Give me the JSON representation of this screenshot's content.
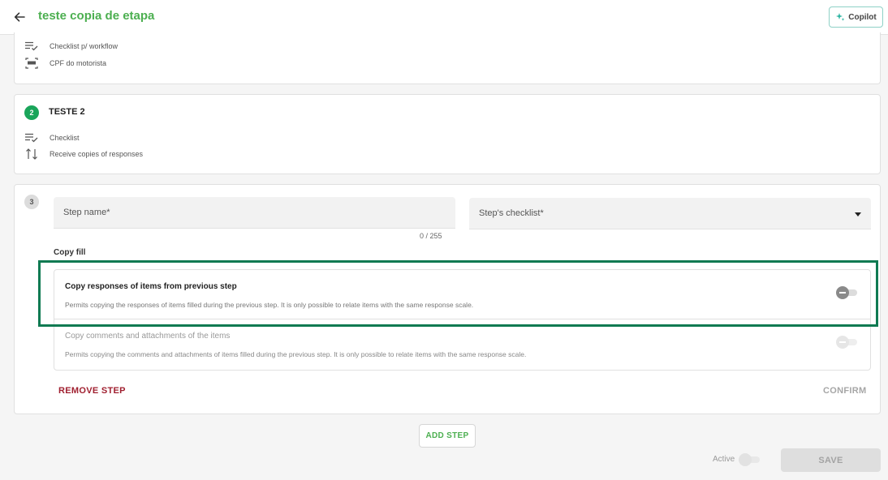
{
  "header": {
    "title": "teste copia de etapa",
    "copilot_label": "Copilot"
  },
  "step1": {
    "items": [
      {
        "label": "Checklist p/ workflow",
        "icon": "checklist-icon"
      },
      {
        "label": "CPF do motorista",
        "icon": "scan-icon"
      }
    ]
  },
  "step2": {
    "number": "2",
    "title": "TESTE 2",
    "items": [
      {
        "label": "Checklist",
        "icon": "checklist-icon"
      },
      {
        "label": "Receive copies of responses",
        "icon": "swap-vertical-icon"
      }
    ]
  },
  "step3": {
    "number": "3",
    "step_name_placeholder": "Step name*",
    "char_counter": "0 / 255",
    "checklist_placeholder": "Step's checklist*",
    "copy_fill_title": "Copy fill",
    "options": [
      {
        "title": "Copy responses of items from previous step",
        "description": "Permits copying the responses of items filled during the previous step. It is only possible to relate items with the same response scale.",
        "enabled": false
      },
      {
        "title": "Copy comments and attachments of the items",
        "description": "Permits copying the comments and attachments of items filled during the previous step. It is only possible to relate items with the same response scale.",
        "enabled": false
      }
    ],
    "remove_label": "REMOVE STEP",
    "confirm_label": "CONFIRM"
  },
  "footer": {
    "add_step_label": "ADD STEP",
    "active_label": "Active",
    "save_label": "SAVE"
  },
  "colors": {
    "brand_green": "#4caf50",
    "step_done": "#1aa55a",
    "remove_red": "#a02030",
    "highlight": "#0f7a52"
  }
}
